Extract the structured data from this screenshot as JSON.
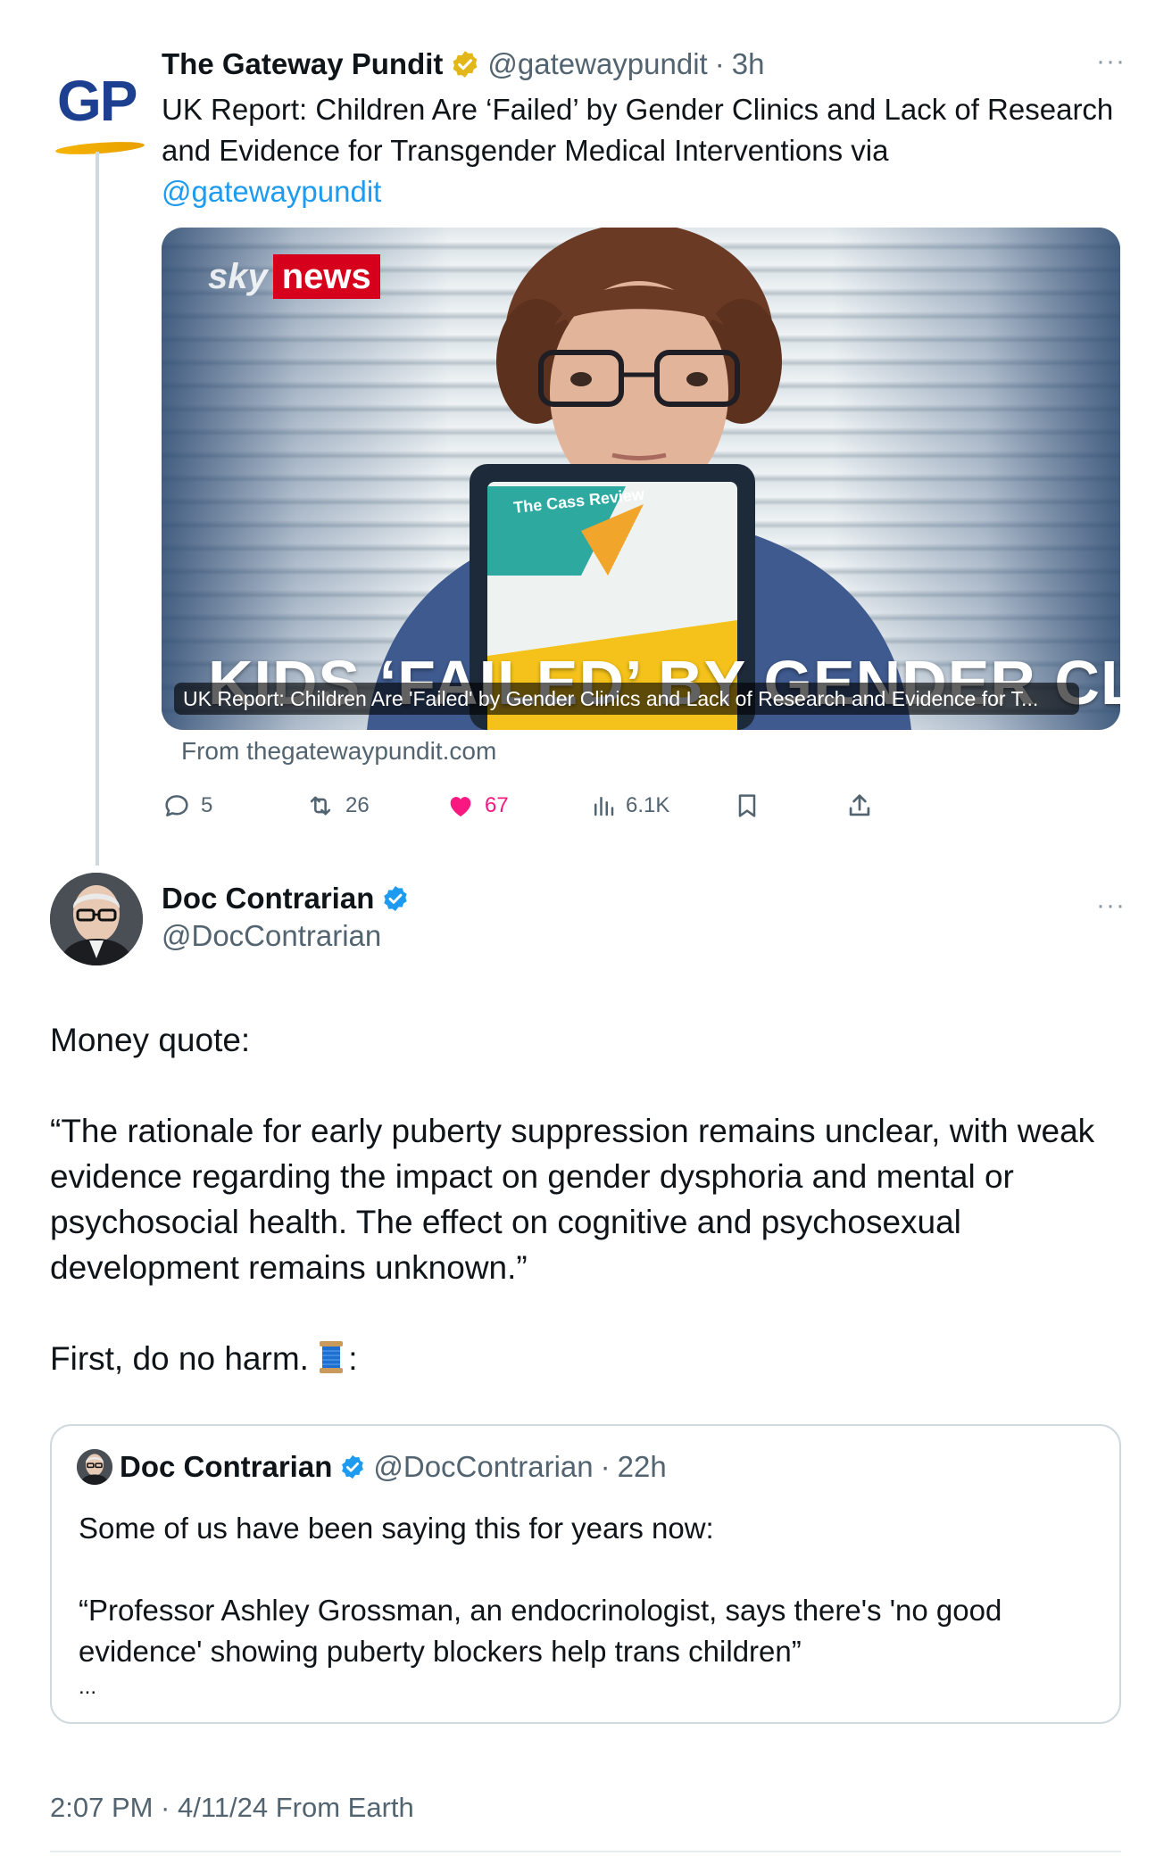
{
  "parent_tweet": {
    "author_name": "The Gateway Pundit",
    "author_handle": "@gatewaypundit",
    "time_ago": "3h",
    "avatar_text": "GP",
    "text": "UK Report: Children Are ‘Failed’ by Gender Clinics and Lack of Research and Evidence for Transgender Medical Interventions via",
    "mention": "@gatewaypundit",
    "card": {
      "broadcaster_sky": "sky",
      "broadcaster_news": "news",
      "headline_overlay": "KIDS ‘FAILED’ BY GENDER CLINICS",
      "tablet_title": "The Cass Review",
      "title": "UK Report: Children Are 'Failed' by Gender Clinics and Lack of Research and Evidence for T...",
      "source": "From thegatewaypundit.com"
    },
    "stats": {
      "replies": "5",
      "retweets": "26",
      "likes": "67",
      "views": "6.1K"
    }
  },
  "main_tweet": {
    "author_name": "Doc Contrarian",
    "author_handle": "@DocContrarian",
    "body": {
      "line1": "Money quote:",
      "quote": "“The rationale for early puberty suppression remains unclear, with weak evidence regarding the impact on gender dysphoria and mental or psychosocial health. The effect on cognitive and psychosexual development remains unknown.”",
      "closing_before": "First, do no harm.",
      "closing_after": ":"
    },
    "quoted": {
      "author_name": "Doc Contrarian",
      "author_handle": "@DocContrarian",
      "time_ago": "22h",
      "line1": "Some of us have been saying this for years now:",
      "quote": "“Professor Ashley Grossman, an endocrinologist, says there's 'no good evidence' showing puberty blockers help trans children”",
      "ellipsis": "..."
    },
    "timestamp": "2:07 PM · 4/11/24 From Earth"
  },
  "ui": {
    "more": "···",
    "dot": "·"
  },
  "icons": {
    "gold_badge": "verified-gold-badge-icon",
    "blue_badge": "verified-blue-badge-icon",
    "reply": "reply-icon",
    "retweet": "retweet-icon",
    "like": "heart-icon",
    "views": "views-icon",
    "bookmark": "bookmark-icon",
    "share": "share-icon",
    "spool": "thread-spool-emoji"
  },
  "colors": {
    "link_blue": "#1d9bf0",
    "like_pink": "#f91880",
    "muted_gray": "#536471",
    "gold": "#e2b719"
  }
}
